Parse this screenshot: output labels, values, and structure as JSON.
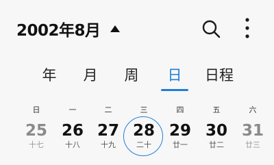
{
  "header": {
    "month_title": "2002年8月"
  },
  "icons": {
    "caret": "caret-up-icon",
    "search": "search-icon",
    "more": "more-vertical-icon"
  },
  "tabs": [
    {
      "label": "年",
      "active": false
    },
    {
      "label": "月",
      "active": false
    },
    {
      "label": "周",
      "active": false
    },
    {
      "label": "日",
      "active": true
    },
    {
      "label": "日程",
      "active": false
    }
  ],
  "weekdays": [
    "日",
    "一",
    "二",
    "三",
    "四",
    "五",
    "六"
  ],
  "week": [
    {
      "day": "25",
      "lunar": "十七",
      "muted": true,
      "selected": false
    },
    {
      "day": "26",
      "lunar": "十八",
      "muted": false,
      "selected": false
    },
    {
      "day": "27",
      "lunar": "十九",
      "muted": false,
      "selected": false
    },
    {
      "day": "28",
      "lunar": "二十",
      "muted": false,
      "selected": true
    },
    {
      "day": "29",
      "lunar": "廿一",
      "muted": false,
      "selected": false
    },
    {
      "day": "30",
      "lunar": "廿二",
      "muted": false,
      "selected": false
    },
    {
      "day": "31",
      "lunar": "廿三",
      "muted": true,
      "selected": false
    }
  ],
  "colors": {
    "accent": "#1e7fd6",
    "background": "#f7f7f7",
    "text": "#111111",
    "muted": "#8a8a8a"
  }
}
